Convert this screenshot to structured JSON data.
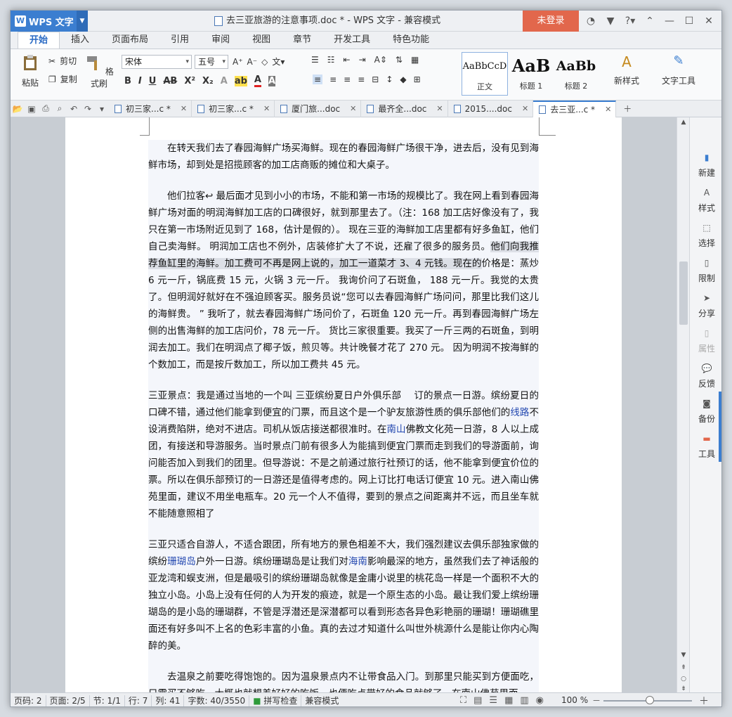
{
  "app": {
    "name": "WPS 文字",
    "logo": "W"
  },
  "window": {
    "title": "去三亚旅游的注意事项.doc * - WPS 文字 - 兼容模式",
    "login_label": "未登录"
  },
  "ribbon_tabs": [
    "开始",
    "插入",
    "页面布局",
    "引用",
    "审阅",
    "视图",
    "章节",
    "开发工具",
    "特色功能"
  ],
  "ribbon": {
    "paste": "粘贴",
    "cut": "剪切",
    "copy": "复制",
    "format_painter": "格式刷",
    "font_name": "宋体",
    "font_size": "五号",
    "styles": [
      {
        "preview": "AaBbCcD",
        "label": "正文"
      },
      {
        "preview": "AaB",
        "label": "标题 1"
      },
      {
        "preview": "AaBb",
        "label": "标题 2"
      }
    ],
    "new_style": "新样式",
    "text_tools": "文字工具"
  },
  "doc_tabs": [
    {
      "label": "初三家...c *"
    },
    {
      "label": "初三家...c *"
    },
    {
      "label": "厦门旅...doc"
    },
    {
      "label": "最齐全...doc"
    },
    {
      "label": "2015....doc"
    },
    {
      "label": "去三亚...c *"
    }
  ],
  "document": {
    "p1": "在转天我们去了春园海鲜广场买海鲜。现在的春园海鲜广场很干净，进去后，没有见到海鲜市场，却到处是招揽顾客的加工店商贩的摊位和大桌子。",
    "p2a": "他们拉客↩ 最后面才见到小小的市场，不能和第一市场的规模比了。我在网上看到春园海鲜广场对面的明润海鲜加工店的口碑很好，就到那里去了。（注：168 加工店好像没有了，我只在第一市场附近见到了 168，估计是假的）。 现在三亚的海鲜加工店里都有好多鱼缸，他们自己卖海鲜。 明润加工店也不例外，店装修扩大了不说，还雇了很多的服务员。",
    "p2hl": "他们向我推荐鱼缸里的海鲜。加工费可不再是网上说的，加工一道菜才 3、4 元钱。现在的",
    "p2b": "价格是：蒸炒 6 元一斤，锅底费 15 元，火锅 3 元一斤。 我询价问了石斑鱼， 188 元一斤。我觉的太贵了。但明润好就好在不强迫顾客买。服务员说“您可以去春园海鲜广场问问，那里比我们这儿的海鲜贵。 ” 我听了，就去春园海鲜广场问价了，石斑鱼 120 元一斤。再到春园海鲜广场左侧的出售海鲜的加工店问价，78 元一斤。 货比三家很重要。我买了一斤三两的石斑鱼，到明润去加工。我们在明润点了椰子饭，煎贝等。共计晚餐才花了 270 元。 因为明润不按海鲜的个数加工，而是按斤数加工，所以加工费共 45 元。",
    "p3a": "三亚景点：我是通过当地的一个叫 三亚缤纷夏日户外俱乐部　 订的景点一日游。缤纷夏日的口碑不错，通过他们能拿到便宜的门票，而且这个是一个驴友旅游性质的俱乐部他们的",
    "p3link1": "线路",
    "p3b": "不设消费陷阱，绝对不进店。司机从饭店接送都很准时。在",
    "p3link2": "南山",
    "p3c": "佛教文化苑一日游，8 人以上成团，有接送和导游服务。当时景点门前有很多人为能搞到便宜门票而走到我们的导游面前，询问能否加入到我们的团里。但导游说：不是之前通过旅行社预订的话，他不能拿到便宜价位的票。所以在俱乐部预订的一日游还是值得考虑的。网上订比打电话订便宜 10 元。进入南山佛苑里面，建议不用坐电瓶车。20 元一个人不值得，要到的景点之间距离并不远，而且坐车就不能随意照相了",
    "p4a": "三亚只适合自游人，不适合跟团，所有地方的景色相差不大，我们强烈建议去俱乐部独家做的缤纷",
    "p4link1": "珊瑚岛",
    "p4b": "户外一日游。缤纷珊瑚岛是让我们对",
    "p4link2": "海南",
    "p4c": "影响最深的地方，虽然我们去了神话般的亚龙湾和蜈支洲，但是最吸引的缤纷珊瑚岛就像是金庸小说里的桃花岛一样是一个面积不大的独立小岛。小岛上没有任何的人为开发的痕迹，就是一个原生态的小岛。最让我们爱上缤纷珊瑚岛的是小岛的珊瑚群，不管是浮潜还是深潜都可以看到形态各异色彩艳丽的珊瑚！珊瑚礁里面还有好多叫不上名的色彩丰富的小鱼。真的去过才知道什么叫世外桃源什么是能让你内心陶醉的美。",
    "p5": "去温泉之前要吃得饱饱的。因为温泉景点内不让带食品入门。到那里只能买到方便面吃，只需买不够吃。大概也就想差好好的吃饭。也便吃点带好的食品就够了。在南山佛苑里面"
  },
  "right_panel": [
    "新建",
    "样式",
    "选择",
    "限制",
    "分享",
    "属性",
    "反馈",
    "备份",
    "工具"
  ],
  "status": {
    "page_num": "页码: 2",
    "pages": "页面: 2/5",
    "section": "节: 1/1",
    "row": "行: 7",
    "col": "列: 41",
    "words": "字数: 40/3550",
    "spellcheck": "拼写检查",
    "compat": "兼容模式",
    "zoom": "100 %",
    "zoom_fraction": 0.52
  },
  "colors": {
    "accent": "#3b7ed0",
    "login": "#e2674c",
    "link": "#2348b0"
  }
}
